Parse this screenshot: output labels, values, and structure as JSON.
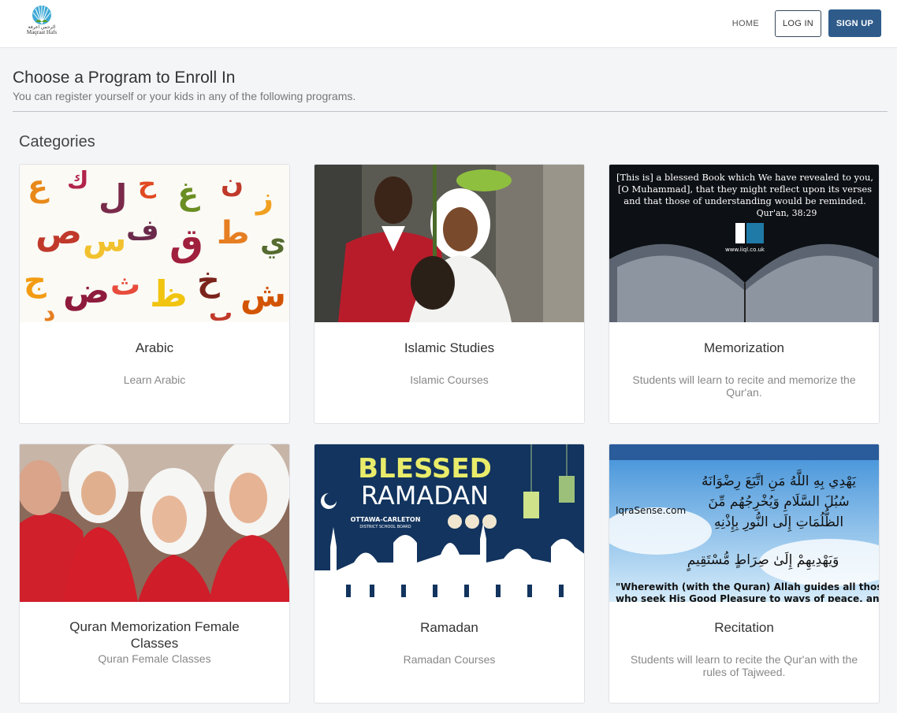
{
  "brand": {
    "logo_text_ar": "الرحمن اعرفة",
    "logo_text_en": "Maqraat Hafs"
  },
  "nav": {
    "home": "HOME",
    "login": "LOG IN",
    "signup": "SIGN UP"
  },
  "header": {
    "title": "Choose a Program to Enroll In",
    "subtitle": "You can register yourself or your kids in any of the following programs."
  },
  "categories": {
    "heading": "Categories",
    "items": [
      {
        "title": "Arabic",
        "description": "Learn Arabic"
      },
      {
        "title": "Islamic Studies",
        "description": "Islamic Courses"
      },
      {
        "title": "Memorization",
        "description": "Students will learn to recite and memorize the Qur'an."
      },
      {
        "title": "Quran Memorization Female Classes",
        "description": "Quran Female Classes"
      },
      {
        "title": "Ramadan",
        "description": "Ramadan Courses"
      },
      {
        "title": "Recitation",
        "description": "Students will learn to recite the Qur'an with the rules of Tajweed."
      }
    ]
  },
  "images": {
    "memorization": {
      "quote_1": "[This is] a blessed Book which We have revealed to you,",
      "quote_2": "[O Muhammad], that they might reflect upon its verses",
      "quote_3": "and that those of understanding would be reminded.",
      "ref": "Qur'an, 38:29",
      "site": "www.iiql.co.uk"
    },
    "ramadan": {
      "line1": "BLESSED",
      "line2": "RAMADAN",
      "board_1": "OTTAWA-CARLETON",
      "board_2": "DISTRICT SCHOOL BOARD"
    },
    "recitation": {
      "site": "IqraSense.com",
      "ayah_1": "يَهْدِي بِهِ اللَّهُ مَنِ اتَّبَعَ رِضْوَانَهُ",
      "ayah_2": "سُبُلَ السَّلَامِ وَيُخْرِجُهُم مِّنَ",
      "ayah_3": "الظُّلُمَاتِ إِلَى النُّورِ بِإِذْنِهِ",
      "ayah_4": "وَيَهْدِيهِمْ إِلَىٰ صِرَاطٍ مُّسْتَقِيمٍ",
      "caption_1": "\"Wherewith (with the Quran) Allah guides all those",
      "caption_2": "who seek His Good Pleasure to ways of peace, and"
    }
  },
  "colors": {
    "primary": "#2e5b8a",
    "page_bg": "#f4f5f7"
  }
}
